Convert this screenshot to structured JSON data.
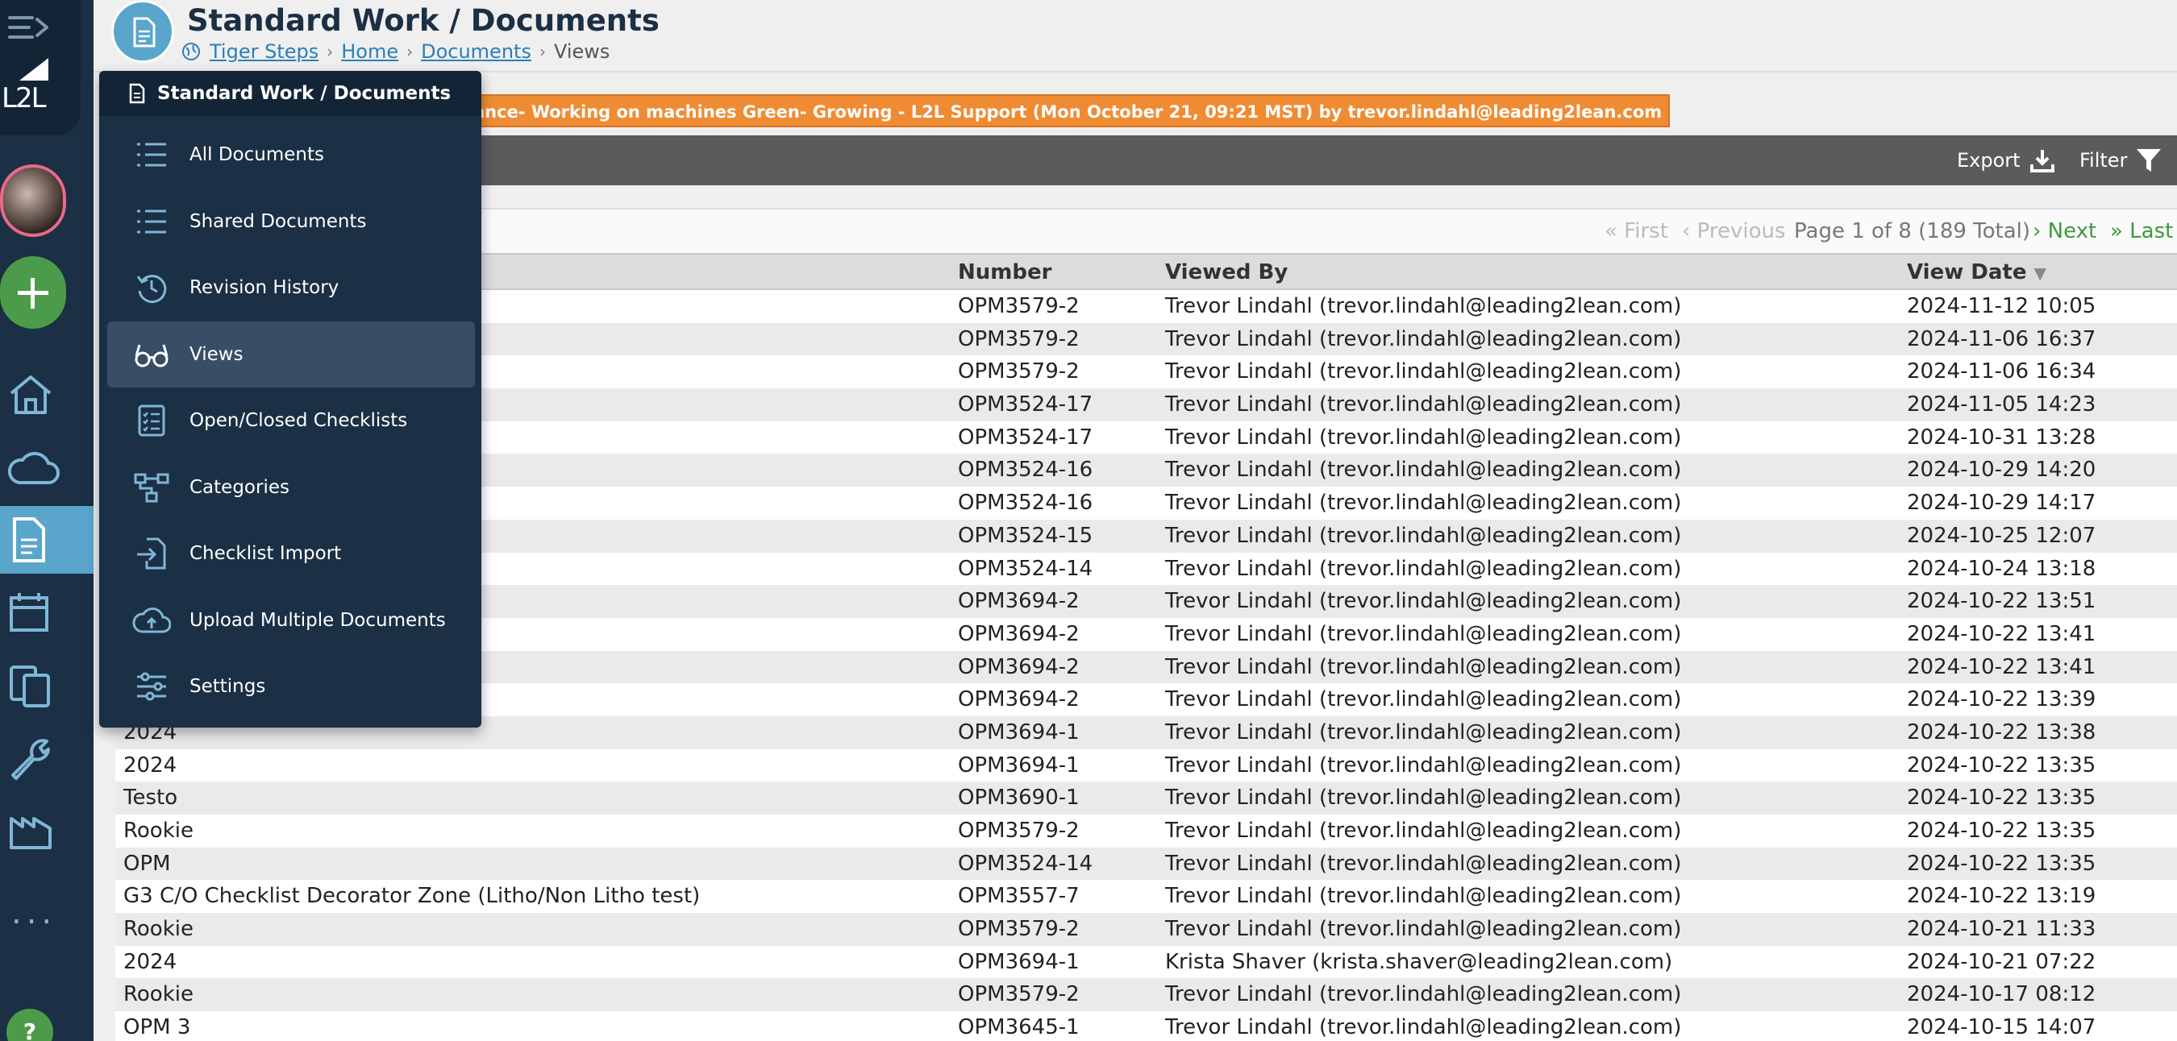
{
  "header": {
    "title": "Standard Work / Documents",
    "breadcrumb": [
      {
        "label": "Tiger Steps",
        "link": true
      },
      {
        "label": "Home",
        "link": true
      },
      {
        "label": "Documents",
        "link": true
      },
      {
        "label": "Views",
        "link": false
      }
    ]
  },
  "rail": {
    "logo_text": "L2L",
    "more_label": "...",
    "help_label": "?"
  },
  "banner": {
    "text": "ance- Working on machines Green- Growing - L2L Support (Mon October 21, 09:21 MST) by trevor.lindahl@leading2lean.com"
  },
  "toolbar": {
    "export_label": "Export",
    "filter_label": "Filter"
  },
  "pager": {
    "first": "« First",
    "previous": "‹ Previous",
    "info": "Page 1 of 8 (189 Total)",
    "next": "› Next",
    "last": "» Last"
  },
  "menu": {
    "title": "Standard Work / Documents",
    "items": [
      {
        "label": "All Documents",
        "icon": "list-icon"
      },
      {
        "label": "Shared Documents",
        "icon": "list-icon"
      },
      {
        "label": "Revision History",
        "icon": "history-icon"
      },
      {
        "label": "Views",
        "icon": "glasses-icon"
      },
      {
        "label": "Open/Closed Checklists",
        "icon": "checklist-icon"
      },
      {
        "label": "Categories",
        "icon": "hierarchy-icon"
      },
      {
        "label": "Checklist Import",
        "icon": "import-icon"
      },
      {
        "label": "Upload Multiple Documents",
        "icon": "cloud-upload-icon"
      },
      {
        "label": "Settings",
        "icon": "sliders-icon"
      }
    ],
    "active_index": 3
  },
  "table": {
    "columns": {
      "number": "Number",
      "viewed_by": "Viewed By",
      "view_date": "View Date",
      "sort_indicator": "▼"
    },
    "rows": [
      {
        "title": "",
        "number": "OPM3579-2",
        "viewer": "Trevor Lindahl (trevor.lindahl@leading2lean.com)",
        "date": "2024-11-12 10:05"
      },
      {
        "title": "",
        "number": "OPM3579-2",
        "viewer": "Trevor Lindahl (trevor.lindahl@leading2lean.com)",
        "date": "2024-11-06 16:37"
      },
      {
        "title": "",
        "number": "OPM3579-2",
        "viewer": "Trevor Lindahl (trevor.lindahl@leading2lean.com)",
        "date": "2024-11-06 16:34"
      },
      {
        "title": "",
        "number": "OPM3524-17",
        "viewer": "Trevor Lindahl (trevor.lindahl@leading2lean.com)",
        "date": "2024-11-05 14:23"
      },
      {
        "title": "",
        "number": "OPM3524-17",
        "viewer": "Trevor Lindahl (trevor.lindahl@leading2lean.com)",
        "date": "2024-10-31 13:28"
      },
      {
        "title": "",
        "number": "OPM3524-16",
        "viewer": "Trevor Lindahl (trevor.lindahl@leading2lean.com)",
        "date": "2024-10-29 14:20"
      },
      {
        "title": "",
        "number": "OPM3524-16",
        "viewer": "Trevor Lindahl (trevor.lindahl@leading2lean.com)",
        "date": "2024-10-29 14:17"
      },
      {
        "title": "",
        "number": "OPM3524-15",
        "viewer": "Trevor Lindahl (trevor.lindahl@leading2lean.com)",
        "date": "2024-10-25 12:07"
      },
      {
        "title": "",
        "number": "OPM3524-14",
        "viewer": "Trevor Lindahl (trevor.lindahl@leading2lean.com)",
        "date": "2024-10-24 13:18"
      },
      {
        "title": "",
        "number": "OPM3694-2",
        "viewer": "Trevor Lindahl (trevor.lindahl@leading2lean.com)",
        "date": "2024-10-22 13:51"
      },
      {
        "title": "",
        "number": "OPM3694-2",
        "viewer": "Trevor Lindahl (trevor.lindahl@leading2lean.com)",
        "date": "2024-10-22 13:41"
      },
      {
        "title": "",
        "number": "OPM3694-2",
        "viewer": "Trevor Lindahl (trevor.lindahl@leading2lean.com)",
        "date": "2024-10-22 13:41"
      },
      {
        "title": "",
        "number": "OPM3694-2",
        "viewer": "Trevor Lindahl (trevor.lindahl@leading2lean.com)",
        "date": "2024-10-22 13:39"
      },
      {
        "title": "2024",
        "number": "OPM3694-1",
        "viewer": "Trevor Lindahl (trevor.lindahl@leading2lean.com)",
        "date": "2024-10-22 13:38"
      },
      {
        "title": "2024",
        "number": "OPM3694-1",
        "viewer": "Trevor Lindahl (trevor.lindahl@leading2lean.com)",
        "date": "2024-10-22 13:35"
      },
      {
        "title": "Testo",
        "number": "OPM3690-1",
        "viewer": "Trevor Lindahl (trevor.lindahl@leading2lean.com)",
        "date": "2024-10-22 13:35"
      },
      {
        "title": "Rookie",
        "number": "OPM3579-2",
        "viewer": "Trevor Lindahl (trevor.lindahl@leading2lean.com)",
        "date": "2024-10-22 13:35"
      },
      {
        "title": "OPM",
        "number": "OPM3524-14",
        "viewer": "Trevor Lindahl (trevor.lindahl@leading2lean.com)",
        "date": "2024-10-22 13:35"
      },
      {
        "title": "G3 C/O Checklist Decorator Zone (Litho/Non Litho test)",
        "number": "OPM3557-7",
        "viewer": "Trevor Lindahl (trevor.lindahl@leading2lean.com)",
        "date": "2024-10-22 13:19"
      },
      {
        "title": "Rookie",
        "number": "OPM3579-2",
        "viewer": "Trevor Lindahl (trevor.lindahl@leading2lean.com)",
        "date": "2024-10-21 11:33"
      },
      {
        "title": "2024",
        "number": "OPM3694-1",
        "viewer": "Krista Shaver (krista.shaver@leading2lean.com)",
        "date": "2024-10-21 07:22"
      },
      {
        "title": "Rookie",
        "number": "OPM3579-2",
        "viewer": "Trevor Lindahl (trevor.lindahl@leading2lean.com)",
        "date": "2024-10-17 08:12"
      },
      {
        "title": "OPM 3",
        "number": "OPM3645-1",
        "viewer": "Trevor Lindahl (trevor.lindahl@leading2lean.com)",
        "date": "2024-10-15 14:07"
      }
    ]
  },
  "colors": {
    "rail_bg": "#1b2f45",
    "accent": "#5aa5cc",
    "banner": "#ef8c33",
    "green": "#4c9b4a"
  }
}
